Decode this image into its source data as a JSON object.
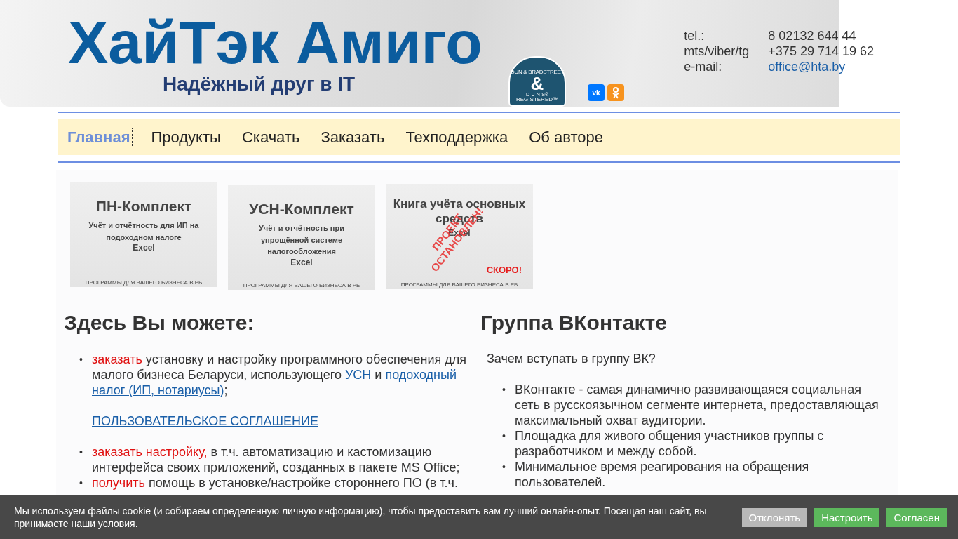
{
  "header": {
    "title": "ХайТэк Амиго",
    "slogan": "Надёжный друг в IT",
    "badge": {
      "arc": "DUN & BRADSTREET",
      "mark": "&",
      "line1": "D-U-N-S®",
      "line2": "REGISTERED™"
    },
    "social": [
      {
        "kind": "vk"
      },
      {
        "kind": "ok"
      }
    ],
    "contacts": [
      {
        "label": "tel.:",
        "value": "8 02132 644 44",
        "kind": "text"
      },
      {
        "label": "mts/viber/tg",
        "value": "+375 29 714 19 62",
        "kind": "text"
      },
      {
        "label": "e-mail:",
        "value": "office@hta.by",
        "kind": "link"
      }
    ]
  },
  "nav": [
    {
      "label": "Главная",
      "selected": true
    },
    {
      "label": "Продукты",
      "selected": false
    },
    {
      "label": "Скачать",
      "selected": false
    },
    {
      "label": "Заказать",
      "selected": false
    },
    {
      "label": "Техподдержка",
      "selected": false
    },
    {
      "label": "Об авторе",
      "selected": false
    }
  ],
  "banners": [
    {
      "title": "ПН-Комплект",
      "subtitle": "Учёт и отчётность для ИП на подоходном налоге",
      "format": "Excel",
      "footer": "ПРОГРАММЫ ДЛЯ ВАШЕГО БИЗНЕСА В РБ"
    },
    {
      "title": "УСН-Комплект",
      "subtitle": "Учёт и отчётность при упрощённой системе налогообложения",
      "format": "Excel",
      "footer": "ПРОГРАММЫ ДЛЯ ВАШЕГО БИЗНЕСА В РБ"
    },
    {
      "title": "Книга учёта основных средств",
      "format": "Excel",
      "footer": "ПРОГРАММЫ ДЛЯ ВАШЕГО БИЗНЕСА В РБ",
      "stamp": "ПРОЕКТ ОСТАНОВЛЕН!",
      "tag": "СКОРО!"
    }
  ],
  "left": {
    "heading": "Здесь Вы можете:",
    "items": [
      {
        "segments": [
          {
            "kind": "accent",
            "text": "заказать"
          },
          {
            "kind": "plain",
            "text": " установку и настройку программного обеспечения для малого бизнеса Беларуси, использующего  "
          },
          {
            "kind": "link",
            "text": "УСН"
          },
          {
            "kind": "plain",
            "text": " и "
          },
          {
            "kind": "link",
            "text": "подоходный налог (ИП, нотариусы)"
          },
          {
            "kind": "plain",
            "text": ";"
          }
        ],
        "note": "ПОЛЬЗОВАТЕЛЬСКОЕ СОГЛАШЕНИЕ"
      },
      {
        "segments": [
          {
            "kind": "accent",
            "text": "заказать настройку,"
          },
          {
            "kind": "plain",
            "text": " в т.ч. автоматизацию и кастомизацию интерфейса своих приложений, созданных в пакете MS Office;"
          }
        ]
      },
      {
        "segments": [
          {
            "kind": "accent",
            "text": "получить"
          },
          {
            "kind": "plain",
            "text": " помощь в установке/настройке стороннего ПО (в т.ч."
          }
        ]
      }
    ],
    "marker": "•"
  },
  "right": {
    "heading": "Группа ВКонтакте",
    "intro": "Зачем вступать в группу ВК?",
    "items": [
      "ВКонтакте - самая динамично развивающаяся социальная сеть в русскоязычном сегменте интернета, предоставляющая максимальный охват аудитории.",
      "Площадка для живого общения участников группы с разработчиком и между собой.",
      "Минимальное время реагирования на обращения пользователей."
    ],
    "marker": "•"
  },
  "cookie": {
    "text": "Мы используем файлы cookie (и собираем определенную личную информацию), чтобы предоставить вам лучший онлайн-опыт. Посещая наш сайт, вы принимаете наши условия.",
    "buttons": [
      {
        "label": "Отклонять",
        "kind": "decline"
      },
      {
        "label": "Настроить",
        "kind": "settings"
      },
      {
        "label": "Согласен",
        "kind": "accept"
      }
    ]
  }
}
